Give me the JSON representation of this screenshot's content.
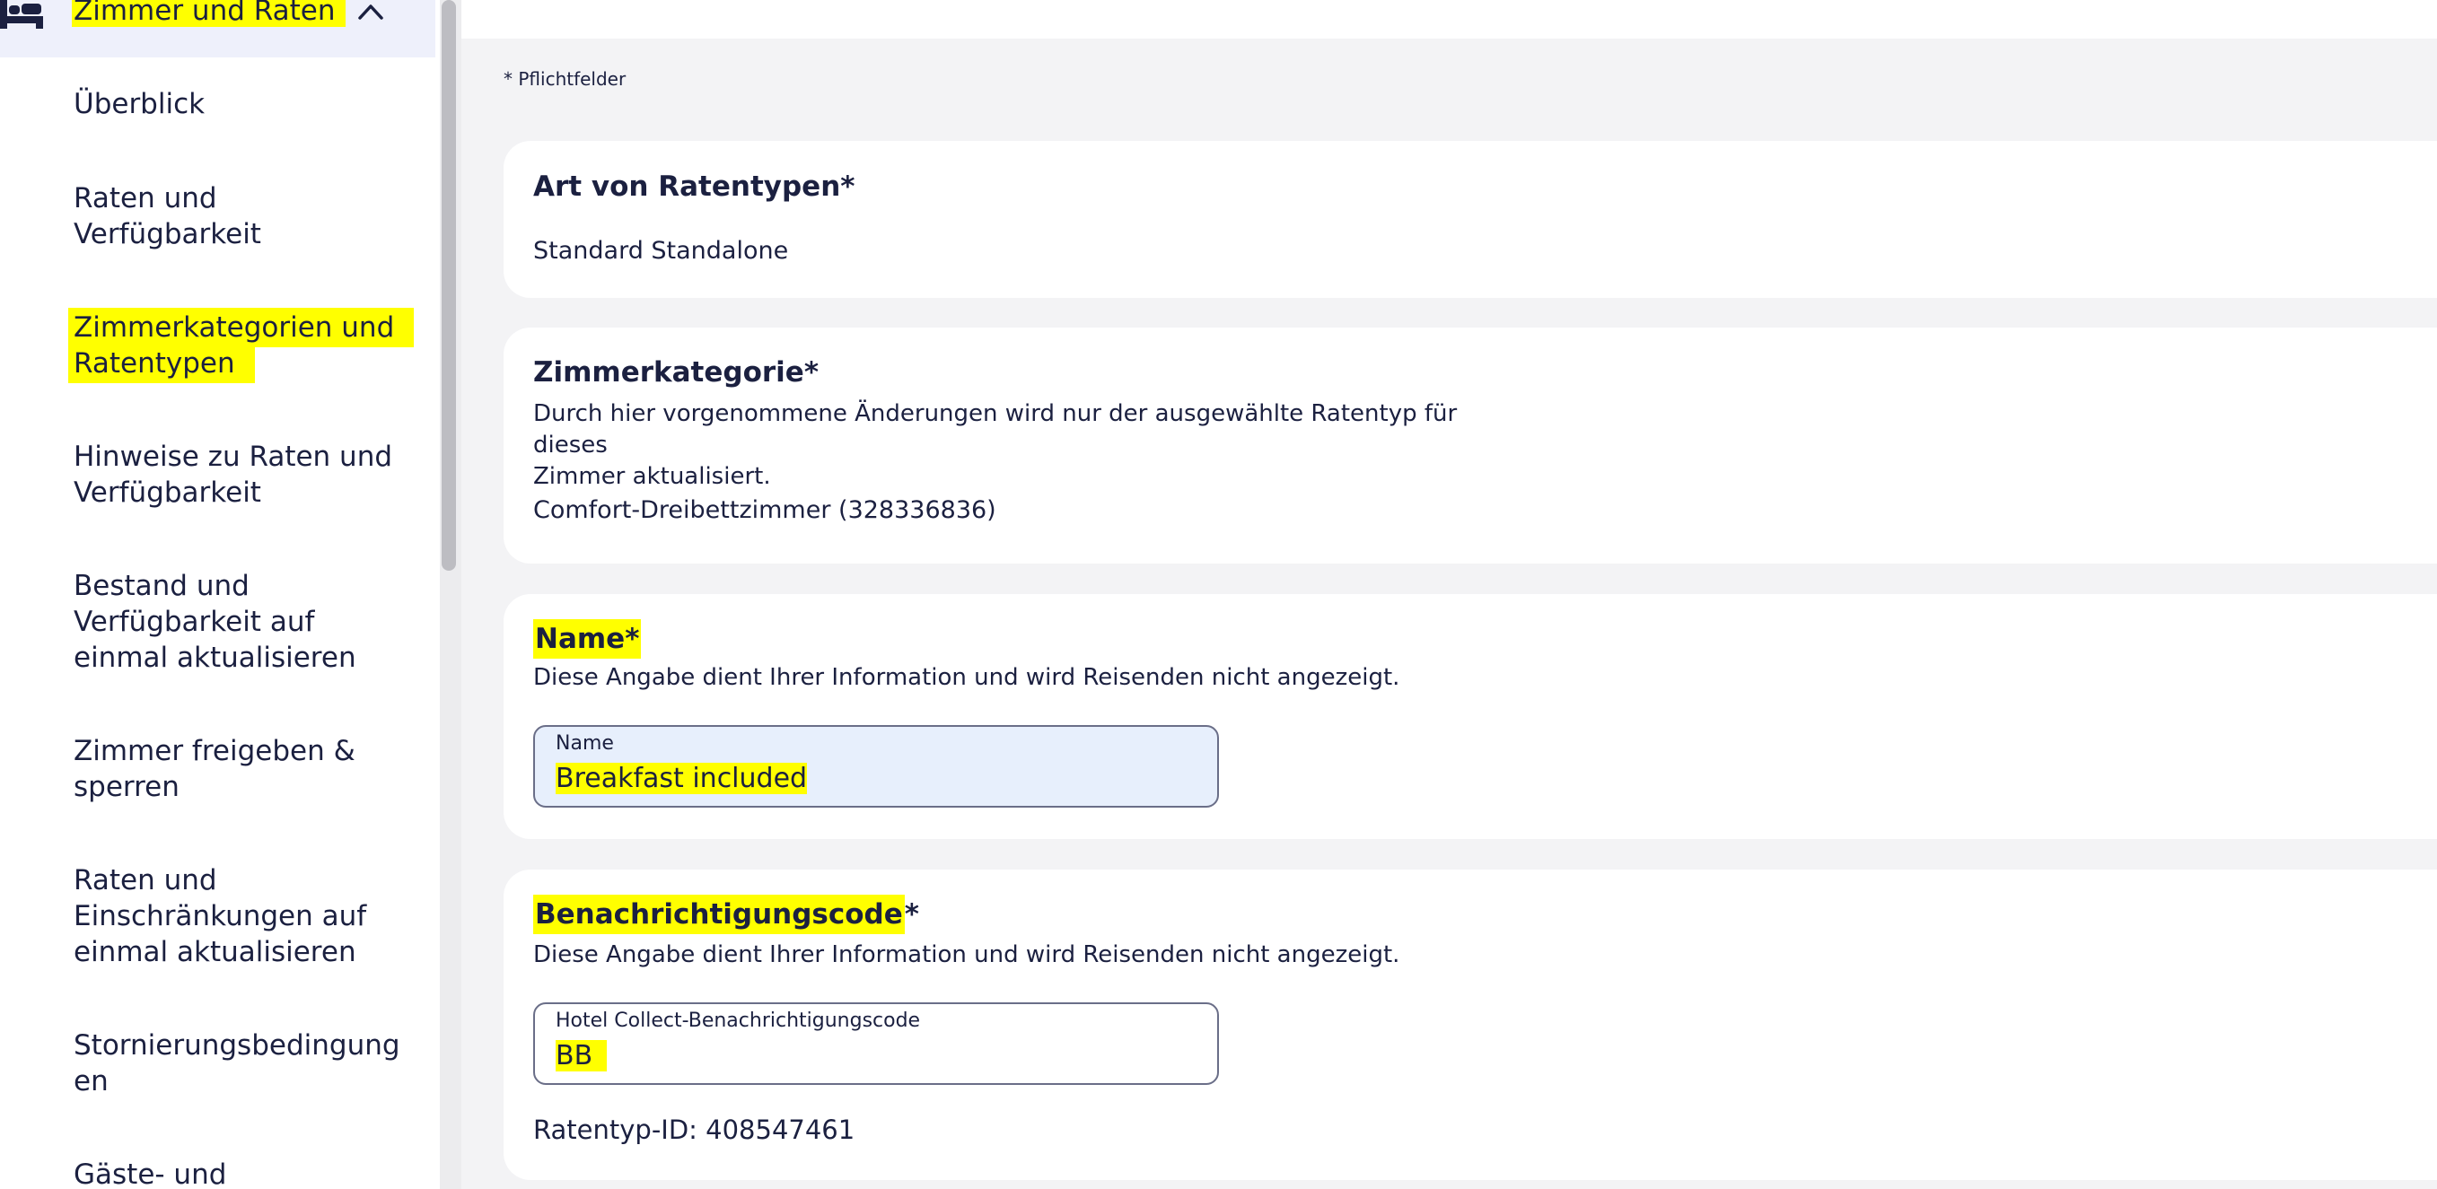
{
  "sidebar": {
    "section_title": "Zimmer und Raten",
    "section_icon": "bed-icon",
    "toggle_icon": "chevron-up-icon",
    "items": [
      {
        "label": "Überblick"
      },
      {
        "label": "Raten und Verfügbarkeit"
      },
      {
        "label": "Zimmerkategorien und Ratentypen",
        "highlighted": true
      },
      {
        "label": "Hinweise zu Raten und Verfügbarkeit"
      },
      {
        "label": "Bestand und Verfügbarkeit auf einmal aktualisieren"
      },
      {
        "label": "Zimmer freigeben & sperren"
      },
      {
        "label": "Raten und Einschränkungen auf einmal aktualisieren"
      },
      {
        "label": "Stornierungsbedingungen"
      },
      {
        "label": "Gäste- und"
      }
    ]
  },
  "main": {
    "required_note": "* Pflichtfelder",
    "rate_type_kind": {
      "title": "Art von Ratentypen*",
      "value": "Standard Standalone"
    },
    "room_category": {
      "title": "Zimmerkategorie*",
      "description_line1": "Durch hier vorgenommene Änderungen wird nur der ausgewählte Ratentyp für dieses",
      "description_line2": "Zimmer aktualisiert.",
      "value": "Comfort-Dreibettzimmer (328336836)"
    },
    "name": {
      "title": "Name*",
      "description": "Diese Angabe dient Ihrer Information und wird Reisenden nicht angezeigt.",
      "field_label": "Name",
      "field_value": "Breakfast included"
    },
    "notification_code": {
      "title_highlighted": "Benachrichtigungscode",
      "title_suffix": "*",
      "description": "Diese Angabe dient Ihrer Information und wird Reisenden nicht angezeigt.",
      "field_label": "Hotel Collect-Benachrichtigungscode",
      "field_value": "BB",
      "rate_type_id": "Ratentyp-ID: 408547461"
    }
  },
  "colors": {
    "highlight": "#ffff00",
    "text": "#1b2040",
    "page_background": "#f3f3f5",
    "active_field_background": "#e7effc",
    "sidebar_header_background": "#eef0fb"
  }
}
